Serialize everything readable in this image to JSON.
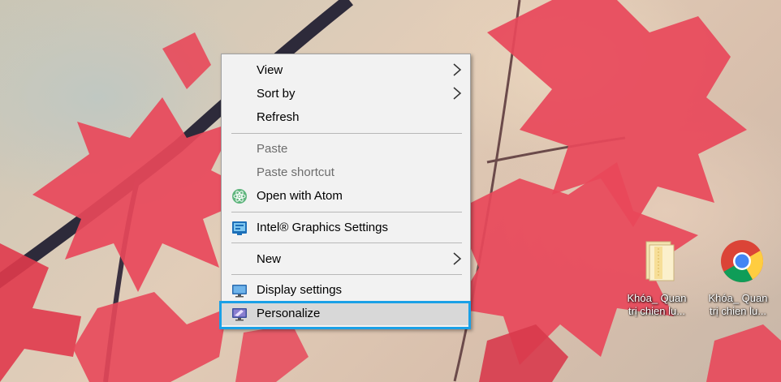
{
  "context_menu": {
    "items": [
      {
        "label": "View",
        "enabled": true,
        "submenu": true,
        "icon": null
      },
      {
        "label": "Sort by",
        "enabled": true,
        "submenu": true,
        "icon": null
      },
      {
        "label": "Refresh",
        "enabled": true,
        "submenu": false,
        "icon": null
      },
      {
        "label": "Paste",
        "enabled": false,
        "submenu": false,
        "icon": null
      },
      {
        "label": "Paste shortcut",
        "enabled": false,
        "submenu": false,
        "icon": null
      },
      {
        "label": "Open with Atom",
        "enabled": true,
        "submenu": false,
        "icon": "atom-icon"
      },
      {
        "label": "Intel® Graphics Settings",
        "enabled": true,
        "submenu": false,
        "icon": "intel-graphics-icon"
      },
      {
        "label": "New",
        "enabled": true,
        "submenu": true,
        "icon": null
      },
      {
        "label": "Display settings",
        "enabled": true,
        "submenu": false,
        "icon": "display-icon"
      },
      {
        "label": "Personalize",
        "enabled": true,
        "submenu": false,
        "icon": "personalize-icon",
        "selected": true
      }
    ],
    "highlight_color": "#1aa0e6"
  },
  "desktop_icons": [
    {
      "label_line1": "Khóa_ Quan",
      "label_line2": "trị chien lu...",
      "icon": "folder-file-icon"
    },
    {
      "label_line1": "Khóa_ Quan",
      "label_line2": "trị chien lu...",
      "icon": "chrome-icon"
    }
  ]
}
